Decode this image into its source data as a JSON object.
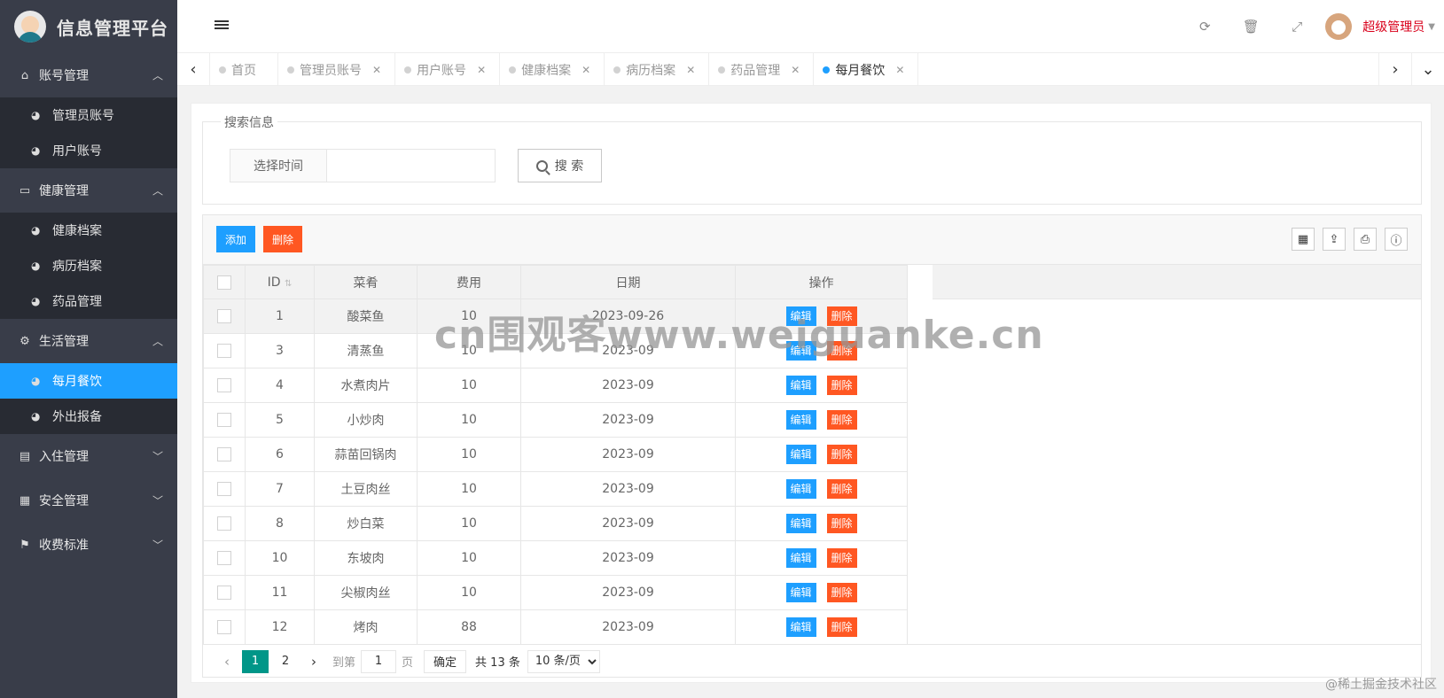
{
  "app": {
    "title": "信息管理平台"
  },
  "sidebar": {
    "groups": [
      {
        "label": "账号管理",
        "expanded": true,
        "items": [
          {
            "label": "管理员账号"
          },
          {
            "label": "用户账号"
          }
        ]
      },
      {
        "label": "健康管理",
        "expanded": true,
        "items": [
          {
            "label": "健康档案"
          },
          {
            "label": "病历档案"
          },
          {
            "label": "药品管理"
          }
        ]
      },
      {
        "label": "生活管理",
        "expanded": true,
        "items": [
          {
            "label": "每月餐饮",
            "active": true
          },
          {
            "label": "外出报备"
          }
        ]
      },
      {
        "label": "入住管理",
        "expanded": false
      },
      {
        "label": "安全管理",
        "expanded": false
      },
      {
        "label": "收费标准",
        "expanded": false
      }
    ]
  },
  "header": {
    "user_name": "超级管理员"
  },
  "tabs": [
    {
      "label": "首页",
      "closable": false
    },
    {
      "label": "管理员账号",
      "closable": true
    },
    {
      "label": "用户账号",
      "closable": true
    },
    {
      "label": "健康档案",
      "closable": true
    },
    {
      "label": "病历档案",
      "closable": true
    },
    {
      "label": "药品管理",
      "closable": true
    },
    {
      "label": "每月餐饮",
      "closable": true,
      "active": true
    }
  ],
  "search": {
    "legend": "搜索信息",
    "label": "选择时间",
    "value": "",
    "button_label": "搜 索"
  },
  "toolbar": {
    "add_label": "添加",
    "delete_label": "删除"
  },
  "table": {
    "columns": [
      "ID",
      "菜肴",
      "费用",
      "日期",
      "操作"
    ],
    "edit_label": "编辑",
    "delete_label": "删除",
    "rows": [
      {
        "id": "1",
        "dish": "酸菜鱼",
        "cost": "10",
        "date": "2023-09-26"
      },
      {
        "id": "3",
        "dish": "清蒸鱼",
        "cost": "10",
        "date": "2023-09"
      },
      {
        "id": "4",
        "dish": "水煮肉片",
        "cost": "10",
        "date": "2023-09"
      },
      {
        "id": "5",
        "dish": "小炒肉",
        "cost": "10",
        "date": "2023-09"
      },
      {
        "id": "6",
        "dish": "蒜苗回锅肉",
        "cost": "10",
        "date": "2023-09"
      },
      {
        "id": "7",
        "dish": "土豆肉丝",
        "cost": "10",
        "date": "2023-09"
      },
      {
        "id": "8",
        "dish": "炒白菜",
        "cost": "10",
        "date": "2023-09"
      },
      {
        "id": "10",
        "dish": "东坡肉",
        "cost": "10",
        "date": "2023-09"
      },
      {
        "id": "11",
        "dish": "尖椒肉丝",
        "cost": "10",
        "date": "2023-09"
      },
      {
        "id": "12",
        "dish": "烤肉",
        "cost": "88",
        "date": "2023-09"
      }
    ]
  },
  "pager": {
    "pages": [
      "1",
      "2"
    ],
    "current": "1",
    "goto_label": "到第",
    "goto_value": "1",
    "page_unit": "页",
    "confirm_label": "确定",
    "total_text": "共 13 条",
    "page_size_option": "10 条/页"
  },
  "watermark": "cn围观客www.weiguanke.cn",
  "footer_mark": "@稀土掘金技术社区",
  "colors": {
    "sidebar_bg": "#393d49",
    "submenu_bg": "#282b33",
    "active": "#1e9fff",
    "danger": "#ff5722",
    "pager_active": "#009688",
    "user_name": "#d9001b"
  }
}
